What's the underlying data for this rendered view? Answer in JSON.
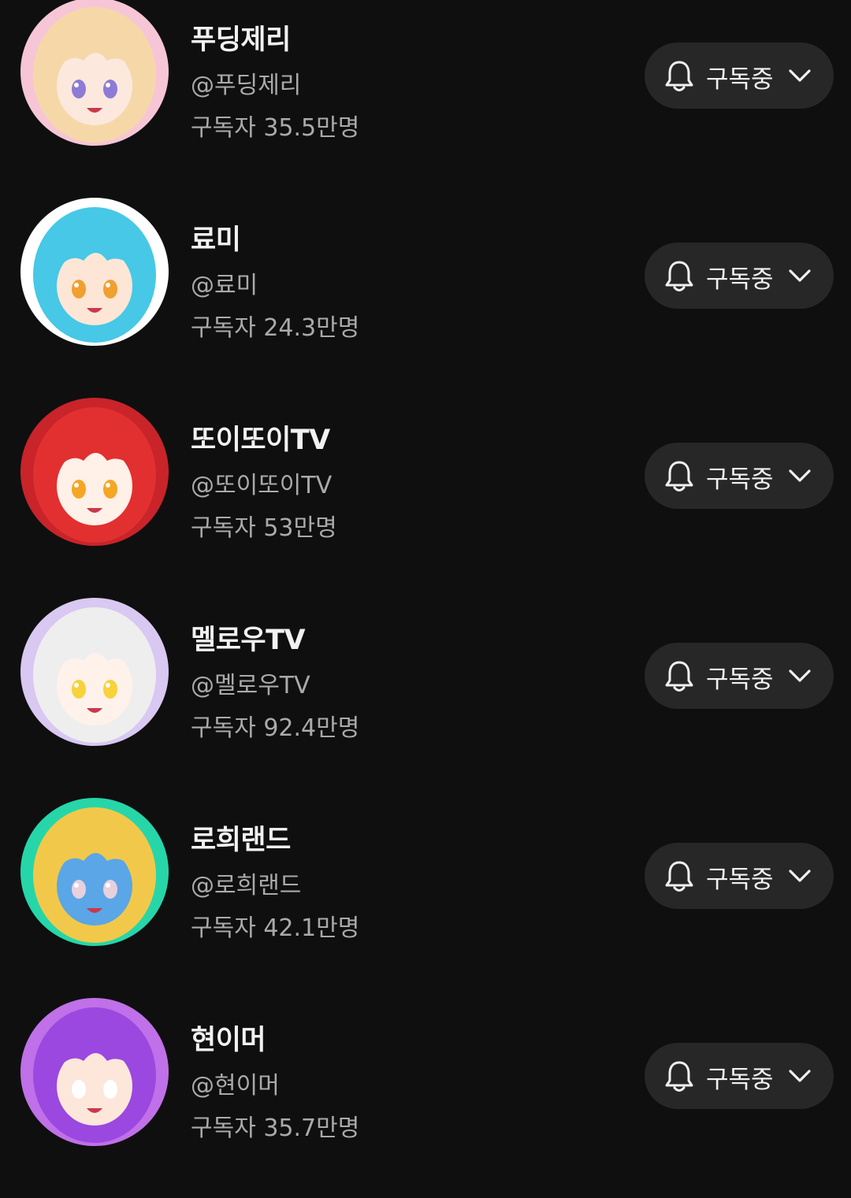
{
  "channels": [
    {
      "name": "푸딩제리",
      "handle": "@푸딩제리",
      "subscribers": "구독자 35.5만명",
      "subscribe_label": "구독중",
      "avatar": {
        "bg": "#f7c6d6",
        "hair": "#f6d8a8",
        "skin": "#fde8dd",
        "accent": "#8e7bd6"
      }
    },
    {
      "name": "료미",
      "handle": "@료미",
      "subscribers": "구독자 24.3만명",
      "subscribe_label": "구독중",
      "avatar": {
        "bg": "#ffffff",
        "hair": "#46c8e6",
        "skin": "#fde6d6",
        "accent": "#f0a030"
      }
    },
    {
      "name": "또이또이TV",
      "handle": "@또이또이TV",
      "subscribers": "구독자 53만명",
      "subscribe_label": "구독중",
      "avatar": {
        "bg": "#c8242a",
        "hair": "#e23030",
        "skin": "#fff0e8",
        "accent": "#f5a623"
      }
    },
    {
      "name": "멜로우TV",
      "handle": "@멜로우TV",
      "subscribers": "구독자 92.4만명",
      "subscribe_label": "구독중",
      "avatar": {
        "bg": "#d8c8f2",
        "hair": "#eeeeee",
        "skin": "#fff2ea",
        "accent": "#f8d23a"
      }
    },
    {
      "name": "로희랜드",
      "handle": "@로희랜드",
      "subscribers": "구독자 42.1만명",
      "subscribe_label": "구독중",
      "avatar": {
        "bg": "#26d6a8",
        "hair": "#f2c84a",
        "skin": "#5aa6e6",
        "accent": "#e8d0dc"
      }
    },
    {
      "name": "현이머",
      "handle": "@현이머",
      "subscribers": "구독자 35.7만명",
      "subscribe_label": "구독중",
      "avatar": {
        "bg": "#c070e8",
        "hair": "#9a48e0",
        "skin": "#fde6da",
        "accent": "#ffffff"
      }
    }
  ],
  "icons": {
    "bell": "bell-icon",
    "chevron": "chevron-down-icon"
  }
}
